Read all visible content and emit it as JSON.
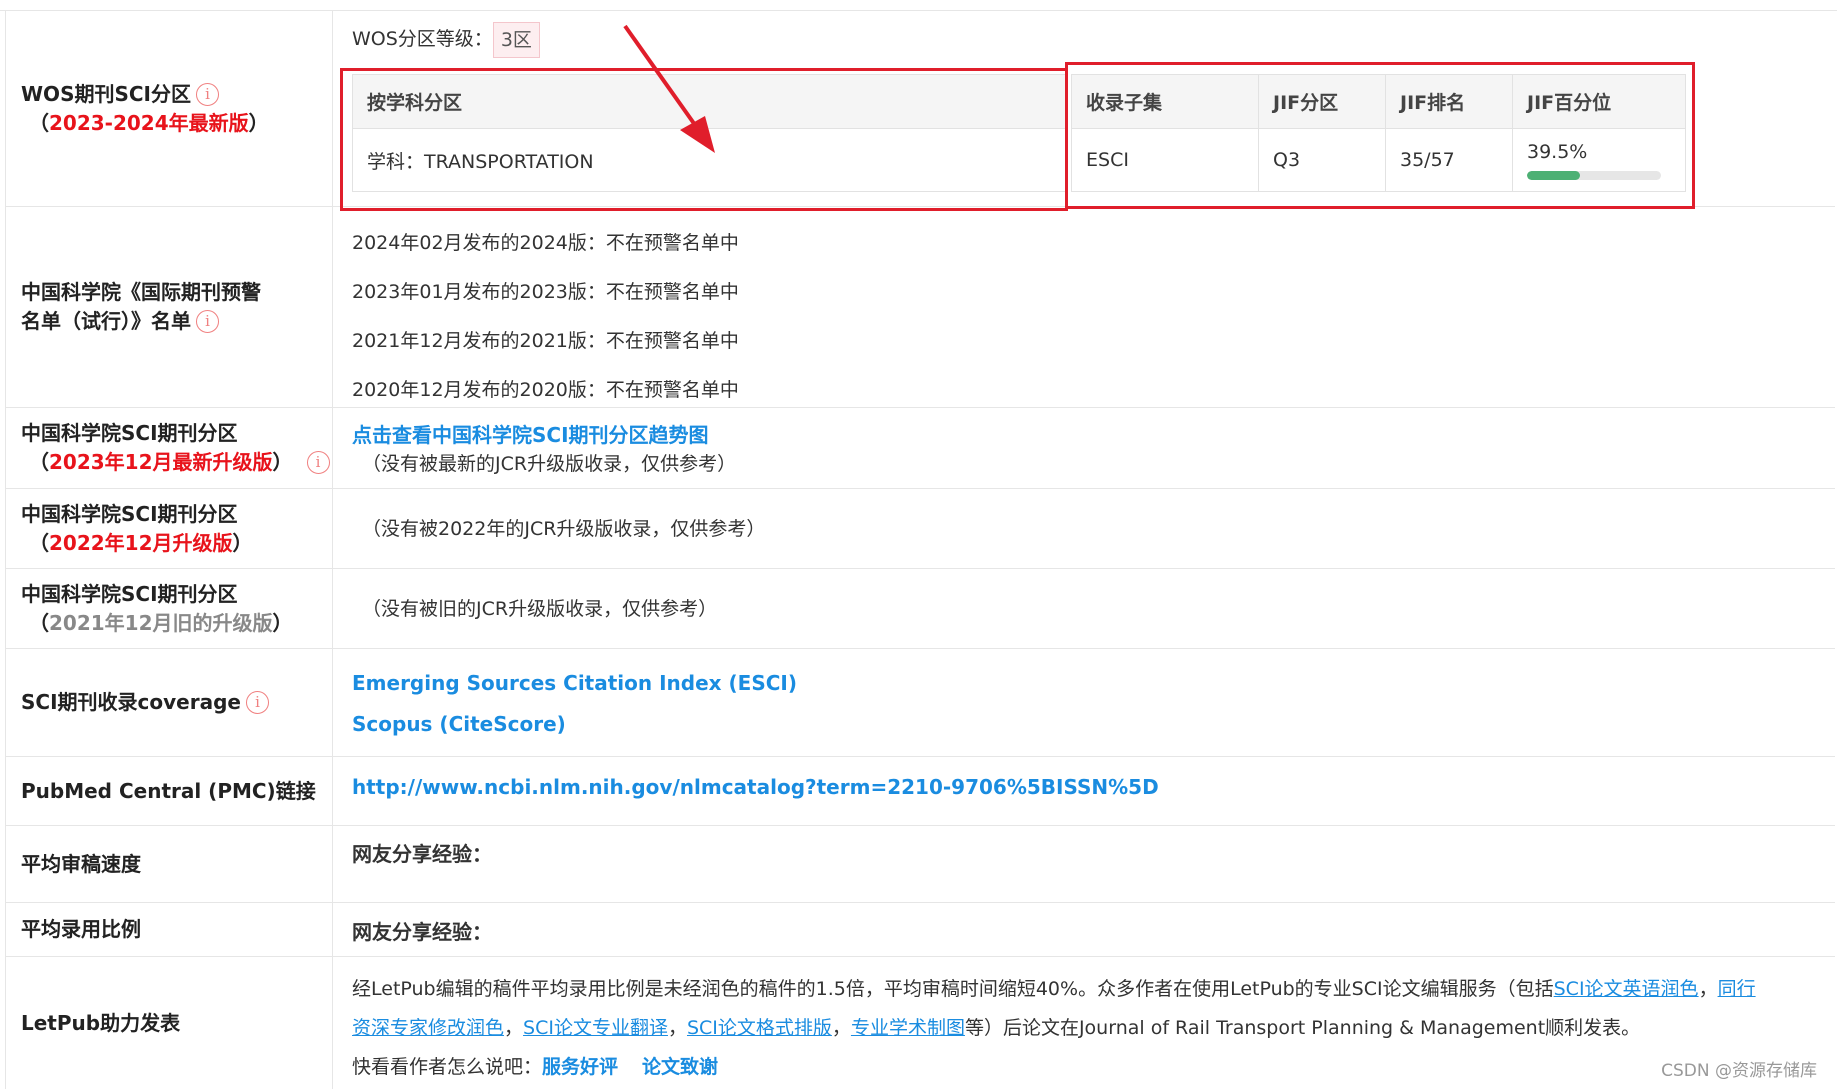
{
  "wos": {
    "label": "WOS期刊SCI分区",
    "sublabel_open": "（",
    "sublabel": "2023-2024年最新版",
    "sublabel_close": "）",
    "level_label": "WOS分区等级：",
    "level_value": "3区",
    "subject_header": "按学科分区",
    "subject_value": "学科：TRANSPORTATION",
    "headers": [
      "收录子集",
      "JIF分区",
      "JIF排名",
      "JIF百分位"
    ],
    "collection": "ESCI",
    "jif_quartile": "Q3",
    "jif_rank": "35/57",
    "jif_percentile": "39.5%",
    "jif_percentile_value": 0.395
  },
  "warning": {
    "label_line1": "中国科学院《国际期刊预警",
    "label_line2": "名单（试行）》名单",
    "items": [
      "2024年02月发布的2024版：不在预警名单中",
      "2023年01月发布的2023版：不在预警名单中",
      "2021年12月发布的2021版：不在预警名单中",
      "2020年12月发布的2020版：不在预警名单中"
    ]
  },
  "cas2023": {
    "label": "中国科学院SCI期刊分区",
    "sublabel_open": "（",
    "sublabel": "2023年12月最新升级版",
    "sublabel_close": "）",
    "link": "点击查看中国科学院SCI期刊分区趋势图",
    "note": "（没有被最新的JCR升级版收录，仅供参考）"
  },
  "cas2022": {
    "label": "中国科学院SCI期刊分区",
    "sublabel_open": "（",
    "sublabel": "2022年12月升级版",
    "sublabel_close": "）",
    "note": "（没有被2022年的JCR升级版收录，仅供参考）"
  },
  "cas2021": {
    "label": "中国科学院SCI期刊分区",
    "sublabel_open": "（",
    "sublabel": "2021年12月旧的升级版",
    "sublabel_close": "）",
    "note": "（没有被旧的JCR升级版收录，仅供参考）"
  },
  "coverage": {
    "label": "SCI期刊收录coverage",
    "items": [
      "Emerging Sources Citation Index (ESCI)",
      "Scopus (CiteScore)"
    ]
  },
  "pmc": {
    "label": "PubMed Central (PMC)链接",
    "link": "http://www.ncbi.nlm.nih.gov/nlmcatalog?term=2210-9706%5BISSN%5D"
  },
  "review_speed": {
    "label": "平均审稿速度",
    "value": "网友分享经验："
  },
  "acceptance": {
    "label": "平均录用比例",
    "value": "网友分享经验："
  },
  "letpub": {
    "label": "LetPub助力发表",
    "text1": "经LetPub编辑的稿件平均录用比例是未经润色的稿件的1.5倍，平均审稿时间缩短40%。众多作者在使用LetPub的专业SCI论文编辑服务（包括",
    "link1": "SCI论文英语润色",
    "sep1": "，",
    "link2a": "同行",
    "link2b": "资深专家修改润色",
    "sep2": "，",
    "link3": "SCI论文专业翻译",
    "sep3": "，",
    "link4": "SCI论文格式排版",
    "sep4": "，",
    "link5": "专业学术制图",
    "text2": "等）后论文在Journal of Rail Transport Planning & Management顺利发表。",
    "prompt": "快看看作者怎么说吧：",
    "link6": "服务好评",
    "link7": "论文致谢"
  },
  "info_icon": "info-icon",
  "accent_red": "#e01e2b",
  "link_blue": "#1a8ce0",
  "watermark": "CSDN @资源存储库"
}
